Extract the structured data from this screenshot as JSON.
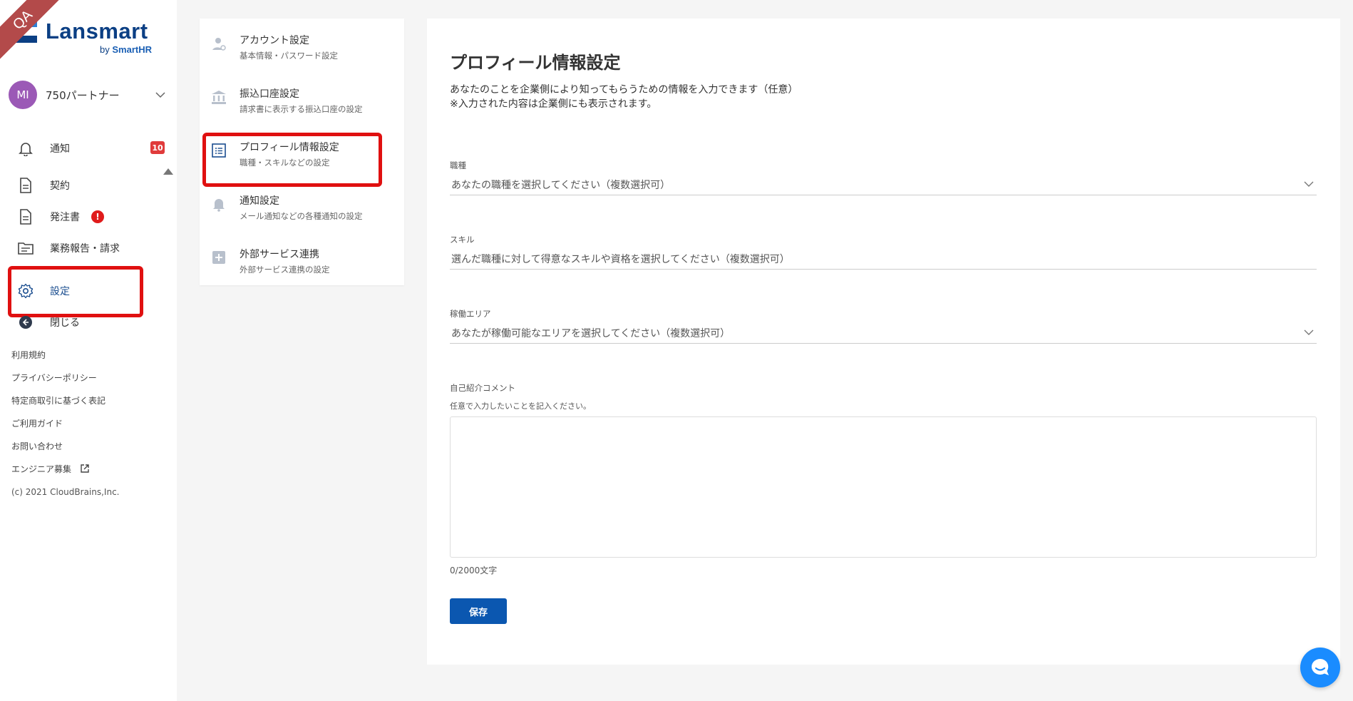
{
  "qa_ribbon": "QA",
  "logo": {
    "name": "Lansmart",
    "by": "by",
    "brand": "SmartHR"
  },
  "account": {
    "initials": "MI",
    "name": "750パートナー"
  },
  "nav": {
    "items": [
      {
        "label": "通知",
        "badge": "10"
      },
      {
        "label": "契約"
      },
      {
        "label": "発注書",
        "info": "!"
      },
      {
        "label": "業務報告・請求"
      },
      {
        "label": "設定"
      },
      {
        "label": "閉じる"
      }
    ]
  },
  "footer": {
    "links": [
      "利用規約",
      "プライバシーポリシー",
      "特定商取引に基づく表記",
      "ご利用ガイド",
      "お問い合わせ",
      "エンジニア募集"
    ],
    "copyright": "(c) 2021 CloudBrains,Inc."
  },
  "settings_menu": [
    {
      "title": "アカウント設定",
      "desc": "基本情報・パスワード設定"
    },
    {
      "title": "振込口座設定",
      "desc": "請求書に表示する振込口座の設定"
    },
    {
      "title": "プロフィール情報設定",
      "desc": "職種・スキルなどの設定"
    },
    {
      "title": "通知設定",
      "desc": "メール通知などの各種通知の設定"
    },
    {
      "title": "外部サービス連携",
      "desc": "外部サービス連携の設定"
    }
  ],
  "main": {
    "title": "プロフィール情報設定",
    "desc_line1": "あなたのことを企業側により知ってもらうための情報を入力できます（任意）",
    "desc_line2": "※入力された内容は企業側にも表示されます。",
    "job": {
      "label": "職種",
      "placeholder": "あなたの職種を選択してください（複数選択可）"
    },
    "skill": {
      "label": "スキル",
      "placeholder": "選んだ職種に対して得意なスキルや資格を選択してください（複数選択可）"
    },
    "area": {
      "label": "稼働エリア",
      "placeholder": "あなたが稼働可能なエリアを選択してください（複数選択可）"
    },
    "comment": {
      "label": "自己紹介コメント",
      "hint": "任意で入力したいことを記入ください。",
      "value": "",
      "counter": "0/2000文字"
    },
    "save_label": "保存"
  },
  "colors": {
    "accent": "#0b57b0",
    "brand": "#0b3f84",
    "highlight": "#e01010",
    "badge": "#e03b3b"
  }
}
